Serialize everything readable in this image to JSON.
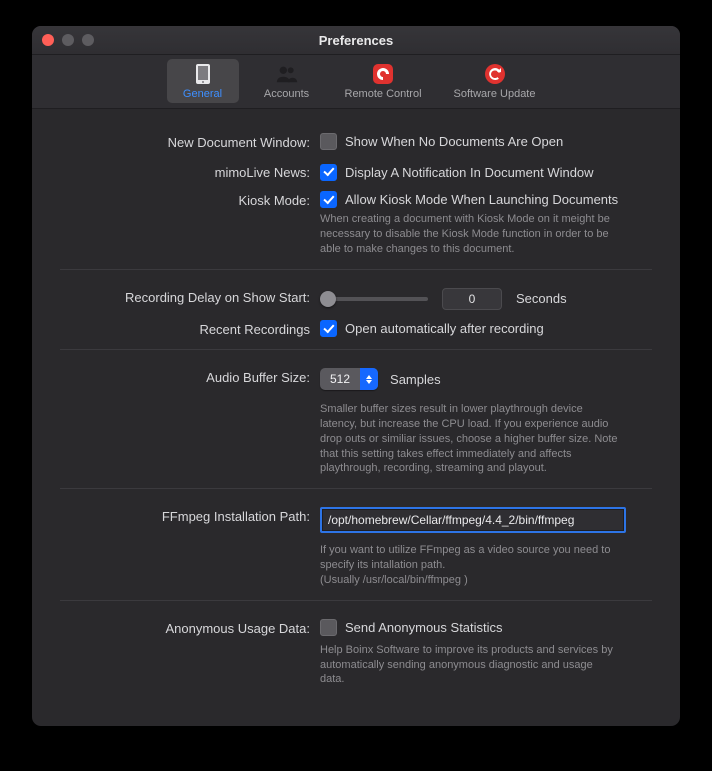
{
  "window": {
    "title": "Preferences"
  },
  "tabs": {
    "general": {
      "label": "General"
    },
    "accounts": {
      "label": "Accounts"
    },
    "remote": {
      "label": "Remote Control"
    },
    "update": {
      "label": "Software Update"
    }
  },
  "rows": {
    "newDoc": {
      "label": "New Document Window:",
      "check": "Show When No Documents Are Open"
    },
    "news": {
      "label": "mimoLive News:",
      "check": "Display A Notification In Document Window"
    },
    "kiosk": {
      "label": "Kiosk Mode:",
      "check": "Allow Kiosk Mode When Launching Documents",
      "help": "When creating a document with Kiosk Mode on it meight be necessary to disable the Kiosk Mode function in order to be able to make changes to this document."
    },
    "delay": {
      "label": "Recording Delay on Show Start:",
      "value": "0",
      "unit": "Seconds"
    },
    "recent": {
      "label": "Recent Recordings",
      "check": "Open automatically after recording"
    },
    "buffer": {
      "label": "Audio Buffer Size:",
      "value": "512",
      "unit": "Samples",
      "help": "Smaller buffer sizes result in lower playthrough device latency, but increase the CPU load. If you experience audio drop outs or similiar issues, choose a higher buffer size. Note that this setting takes effect immediately and affects playthrough, recording, streaming and playout."
    },
    "ffmpeg": {
      "label": "FFmpeg Installation Path:",
      "value": "/opt/homebrew/Cellar/ffmpeg/4.4_2/bin/ffmpeg",
      "help": "If you want to utilize FFmpeg as a video source you need to specify its intallation path.\n(Usually /usr/local/bin/ffmpeg )"
    },
    "anon": {
      "label": "Anonymous Usage Data:",
      "check": "Send Anonymous Statistics",
      "help": "Help Boinx Software to improve its products and services by automatically sending anonymous diagnostic and usage data."
    }
  }
}
